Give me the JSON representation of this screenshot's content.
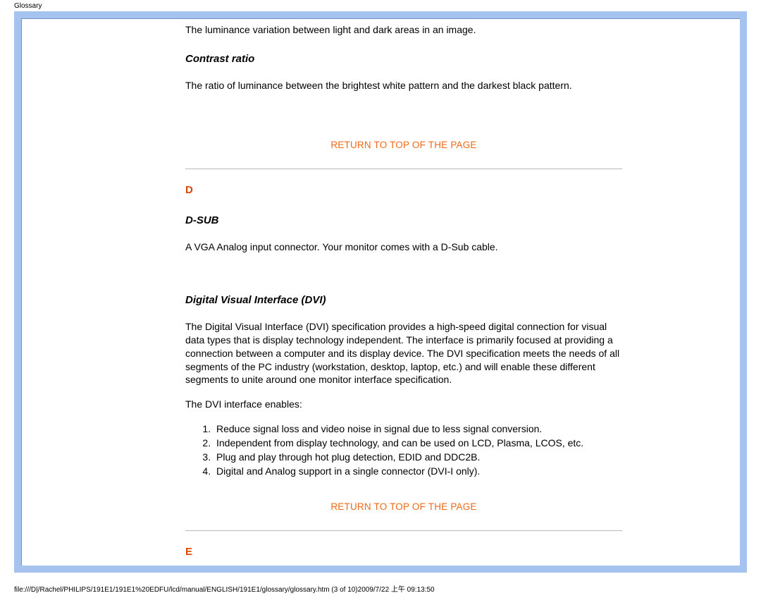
{
  "page_title": "Glossary",
  "intro_paragraph": "The luminance variation between light and dark areas in an image.",
  "contrast_ratio": {
    "heading": "Contrast ratio",
    "text": "The ratio of luminance between the brightest white pattern and the darkest black pattern."
  },
  "return_link": "RETURN TO TOP OF THE PAGE",
  "section_d": {
    "letter": "D",
    "dsub_heading": "D-SUB",
    "dsub_text": "A VGA Analog input connector. Your monitor comes with a D-Sub cable.",
    "dvi_heading": "Digital Visual Interface (DVI)",
    "dvi_text": "The Digital Visual Interface (DVI) specification provides a high-speed digital connection for visual data types that is display technology independent. The interface is primarily focused at providing a connection between a computer and its display device. The DVI specification meets the needs of all segments of the PC industry (workstation, desktop, laptop, etc.) and will enable these different segments to unite around one monitor interface specification.",
    "dvi_enables": "The DVI interface enables:",
    "dvi_list": [
      "Reduce signal loss and video noise in signal due to less signal conversion.",
      "Independent from display technology, and can be used on LCD, Plasma, LCOS, etc.",
      "Plug and play through hot plug detection, EDID and DDC2B.",
      "Digital and Analog support in a single connector (DVI-I only)."
    ]
  },
  "section_e": {
    "letter": "E"
  },
  "footer": "file:///D|/Rachel/PHILIPS/191E1/191E1%20EDFU/lcd/manual/ENGLISH/191E1/glossary/glossary.htm (3 of 10)2009/7/22 上午 09:13:50"
}
